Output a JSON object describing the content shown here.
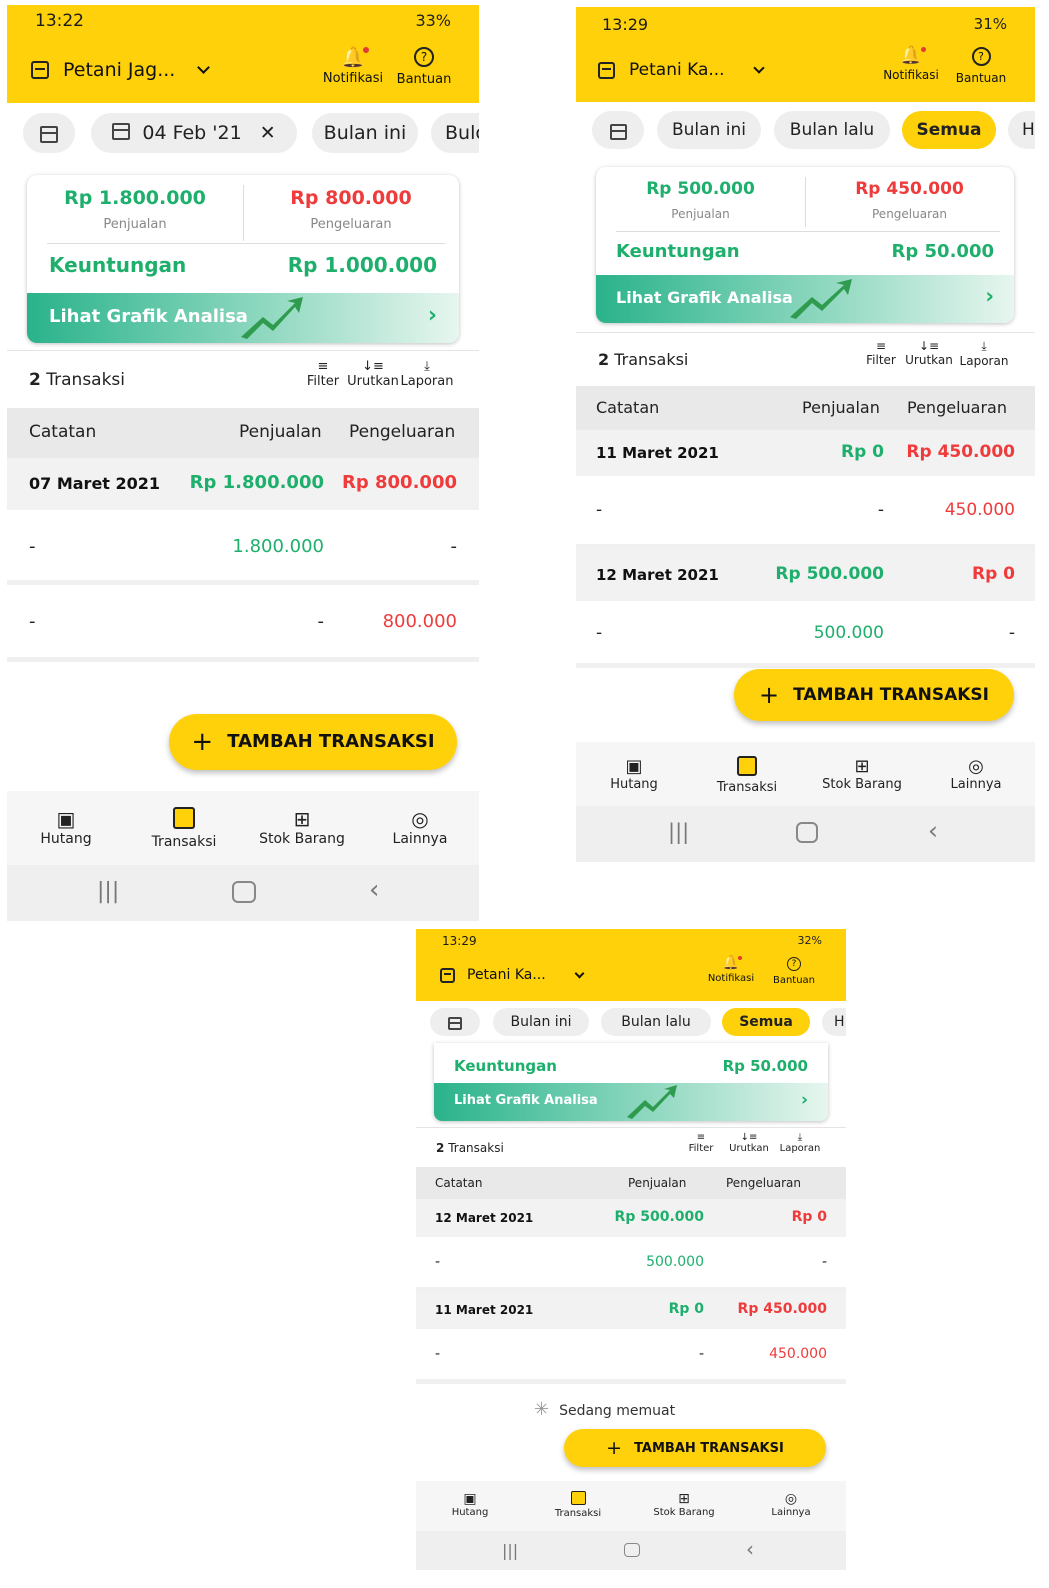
{
  "screens": [
    {
      "status": {
        "time": "13:22",
        "battery": "33%"
      },
      "store_name": "Petani Jag...",
      "notif_label": "Notifikasi",
      "help_label": "Bantuan",
      "filters": {
        "date": "04 Feb '21",
        "this_month": "Bulan ini",
        "last_month": "Bulc"
      },
      "summary": {
        "sales": "Rp 1.800.000",
        "sales_label": "Penjualan",
        "expense": "Rp 800.000",
        "expense_label": "Pengeluaran",
        "profit_label": "Keuntungan",
        "profit": "Rp 1.000.000",
        "graph_label": "Lihat Grafik Analisa"
      },
      "toolbar": {
        "count": "2",
        "count_label": "Transaksi",
        "filter": "Filter",
        "sort": "Urutkan",
        "report": "Laporan"
      },
      "columns": {
        "note": "Catatan",
        "sales": "Penjualan",
        "expense": "Pengeluaran"
      },
      "groups": [
        {
          "date": "07 Maret 2021",
          "sales": "Rp 1.800.000",
          "expense": "Rp 800.000",
          "items": [
            {
              "note": "-",
              "sales": "1.800.000",
              "expense": "-"
            },
            {
              "note": "-",
              "sales": "-",
              "expense": "800.000"
            }
          ]
        }
      ],
      "add_label": "TAMBAH TRANSAKSI",
      "nav": [
        "Hutang",
        "Transaksi",
        "Stok Barang",
        "Lainnya"
      ]
    },
    {
      "status": {
        "time": "13:29",
        "battery": "31%"
      },
      "store_name": "Petani Ka...",
      "notif_label": "Notifikasi",
      "help_label": "Bantuan",
      "filters": {
        "this_month": "Bulan ini",
        "last_month": "Bulan lalu",
        "all": "Semua",
        "more": "H"
      },
      "summary": {
        "sales": "Rp 500.000",
        "sales_label": "Penjualan",
        "expense": "Rp 450.000",
        "expense_label": "Pengeluaran",
        "profit_label": "Keuntungan",
        "profit": "Rp 50.000",
        "graph_label": "Lihat Grafik Analisa"
      },
      "toolbar": {
        "count": "2",
        "count_label": "Transaksi",
        "filter": "Filter",
        "sort": "Urutkan",
        "report": "Laporan"
      },
      "columns": {
        "note": "Catatan",
        "sales": "Penjualan",
        "expense": "Pengeluaran"
      },
      "groups": [
        {
          "date": "11 Maret 2021",
          "sales": "Rp 0",
          "expense": "Rp 450.000",
          "items": [
            {
              "note": "-",
              "sales": "-",
              "expense": "450.000"
            }
          ]
        },
        {
          "date": "12 Maret 2021",
          "sales": "Rp 500.000",
          "expense": "Rp 0",
          "items": [
            {
              "note": "-",
              "sales": "500.000",
              "expense": "-"
            }
          ]
        }
      ],
      "add_label": "TAMBAH TRANSAKSI",
      "nav": [
        "Hutang",
        "Transaksi",
        "Stok Barang",
        "Lainnya"
      ]
    },
    {
      "status": {
        "time": "13:29",
        "battery": "32%"
      },
      "store_name": "Petani Ka...",
      "notif_label": "Notifikasi",
      "help_label": "Bantuan",
      "filters": {
        "this_month": "Bulan ini",
        "last_month": "Bulan lalu",
        "all": "Semua",
        "more": "H"
      },
      "summary": {
        "profit_label": "Keuntungan",
        "profit": "Rp 50.000",
        "graph_label": "Lihat Grafik Analisa"
      },
      "toolbar": {
        "count": "2",
        "count_label": "Transaksi",
        "filter": "Filter",
        "sort": "Urutkan",
        "report": "Laporan"
      },
      "columns": {
        "note": "Catatan",
        "sales": "Penjualan",
        "expense": "Pengeluaran"
      },
      "groups": [
        {
          "date": "12 Maret 2021",
          "sales": "Rp 500.000",
          "expense": "Rp 0",
          "items": [
            {
              "note": "-",
              "sales": "500.000",
              "expense": "-"
            }
          ]
        },
        {
          "date": "11 Maret 2021",
          "sales": "Rp 0",
          "expense": "Rp 450.000",
          "items": [
            {
              "note": "-",
              "sales": "-",
              "expense": "450.000"
            }
          ]
        }
      ],
      "loading": "Sedang memuat",
      "add_label": "TAMBAH TRANSAKSI",
      "nav": [
        "Hutang",
        "Transaksi",
        "Stok Barang",
        "Lainnya"
      ]
    }
  ],
  "colors": {
    "brand_yellow": "#fed10a",
    "sales_green": "#1eaf6c",
    "expense_red": "#ef3b3b"
  }
}
